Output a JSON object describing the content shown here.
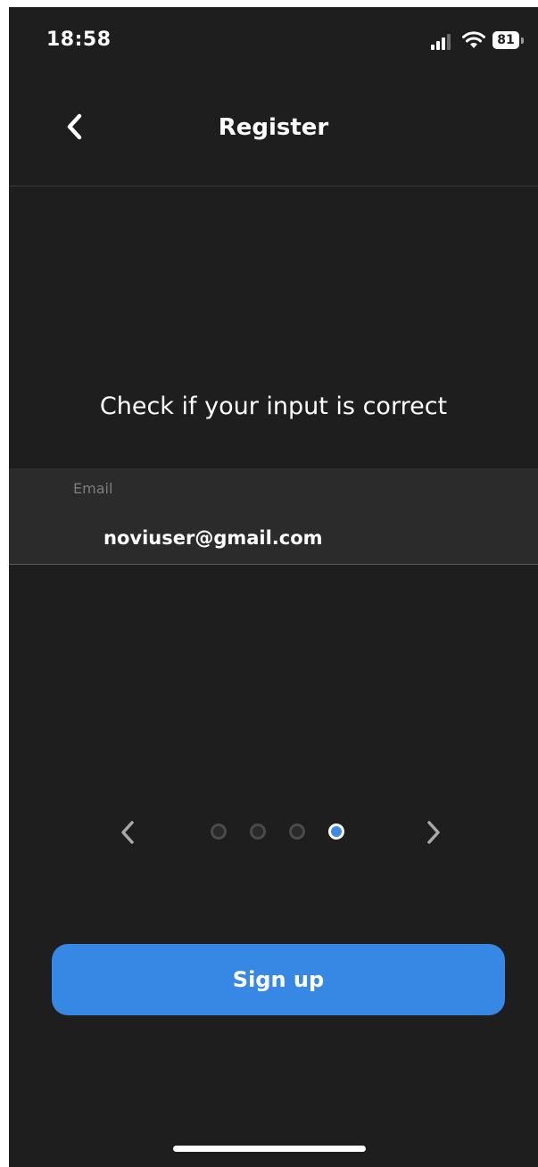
{
  "status_bar": {
    "time": "18:58",
    "battery": "81",
    "icons": [
      "signal-icon",
      "wifi-icon",
      "battery-icon"
    ]
  },
  "nav": {
    "title": "Register",
    "back_icon": "chevron-left-icon"
  },
  "main": {
    "prompt": "Check if your input is correct",
    "field": {
      "label": "Email",
      "value": "noviuser@gmail.com"
    }
  },
  "pager": {
    "prev_icon": "chevron-left-icon",
    "next_icon": "chevron-right-icon",
    "total_steps": 4,
    "active_step": 4
  },
  "actions": {
    "signup_label": "Sign up"
  },
  "colors": {
    "background": "#1e1e1f",
    "field_background": "#2b2b2c",
    "accent": "#3787e4",
    "label_gray": "#7c7c7e"
  }
}
